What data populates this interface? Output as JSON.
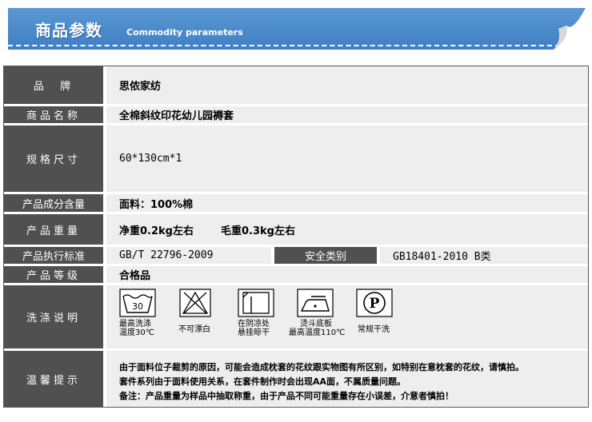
{
  "banner": {
    "title": "商品参数",
    "subtitle": "Commodity parameters"
  },
  "rows": {
    "brand": {
      "label": "品  牌",
      "value": "思侬家纺"
    },
    "name": {
      "label": "商品名称",
      "value": "全棉斜纹印花幼儿园褥套"
    },
    "size": {
      "label": "规格尺寸",
      "value": "60*130cm*1"
    },
    "material": {
      "label": "产品成分含量",
      "value": "面料：100%棉"
    },
    "weight": {
      "label": "产品重量",
      "net": "净重0.2kg左右",
      "gross": "毛重0.3kg左右"
    },
    "standard": {
      "label": "产品执行标准",
      "value": "GB/T 22796-2009",
      "safety_label": "安全类别",
      "safety_value": "GB18401-2010 B类"
    },
    "grade": {
      "label": "产品等级",
      "value": "合格品"
    },
    "wash": {
      "label": "洗涤说明",
      "icons": [
        {
          "name": "wash-30-icon",
          "temp": "30",
          "caption1": "最高洗涤",
          "caption2": "温度30℃"
        },
        {
          "name": "no-bleach-icon",
          "caption1": "不可漂白",
          "caption2": ""
        },
        {
          "name": "hang-dry-shade-icon",
          "caption1": "在阴凉处",
          "caption2": "悬挂晾干"
        },
        {
          "name": "iron-110-icon",
          "caption1": "烫斗底板",
          "caption2": "最高温度110℃"
        },
        {
          "name": "dry-clean-p-icon",
          "letter": "P",
          "caption1": "常规干洗",
          "caption2": ""
        }
      ]
    },
    "notes": {
      "label": "温馨提示",
      "lines": [
        "由于面料位子裁剪的原因，可能会造成枕套的花纹跟实物图有所区别，如特别在意枕套的花纹，请慎拍。",
        "套件系列由于面料使用关系，在套件制作时会出现AA面，不属质量问题。",
        "备注：产品重量为样品中抽取称重，由于产品不同可能重量存在小误差，介意者慎拍！"
      ]
    }
  }
}
